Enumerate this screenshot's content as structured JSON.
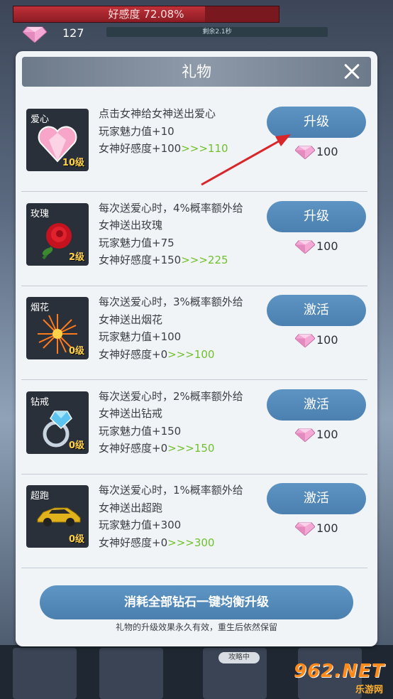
{
  "hud": {
    "favor_text": "好感度 72.08%",
    "favor_progress": 0.7208,
    "gem_count": "127",
    "timer_text": "剩余2.1秒"
  },
  "background": {
    "tag_text": "攻略中"
  },
  "modal": {
    "title": "礼物",
    "items": [
      {
        "name": "爱心",
        "level": "10级",
        "icon": "heart-gem-icon",
        "lines": [
          "点击女神给女神送出爱心",
          "玩家魅力值+10"
        ],
        "favor_base": "女神好感度+100",
        "favor_next": ">>>110",
        "button": "升级",
        "cost": "100"
      },
      {
        "name": "玫瑰",
        "level": "2级",
        "icon": "rose-icon",
        "lines": [
          "每次送爱心时，4%概率额外给",
          "女神送出玫瑰",
          "玩家魅力值+75"
        ],
        "favor_base": "女神好感度+150",
        "favor_next": ">>>225",
        "button": "升级",
        "cost": "100"
      },
      {
        "name": "烟花",
        "level": "0级",
        "icon": "firework-icon",
        "lines": [
          "每次送爱心时，3%概率额外给",
          "女神送出烟花",
          "玩家魅力值+100"
        ],
        "favor_base": "女神好感度+0",
        "favor_next": ">>>100",
        "button": "激活",
        "cost": "100"
      },
      {
        "name": "钻戒",
        "level": "0级",
        "icon": "diamond-ring-icon",
        "lines": [
          "每次送爱心时，2%概率额外给",
          "女神送出钻戒",
          "玩家魅力值+150"
        ],
        "favor_base": "女神好感度+0",
        "favor_next": ">>>150",
        "button": "激活",
        "cost": "100"
      },
      {
        "name": "超跑",
        "level": "0级",
        "icon": "sports-car-icon",
        "lines": [
          "每次送爱心时，1%概率额外给",
          "女神送出超跑",
          "玩家魅力值+300"
        ],
        "favor_base": "女神好感度+0",
        "favor_next": ">>>300",
        "button": "激活",
        "cost": "100"
      }
    ],
    "balance_button": "消耗全部钻石一键均衡升级",
    "note": "礼物的升级效果永久有效，重生后依然保留"
  },
  "watermark": {
    "top": "962.NET",
    "bottom": "乐游网"
  },
  "colors": {
    "button_blue": "#4f86b6",
    "highlight_green": "#6fc02c",
    "level_gold": "#ffd24a",
    "arrow_red": "#d8262a"
  }
}
